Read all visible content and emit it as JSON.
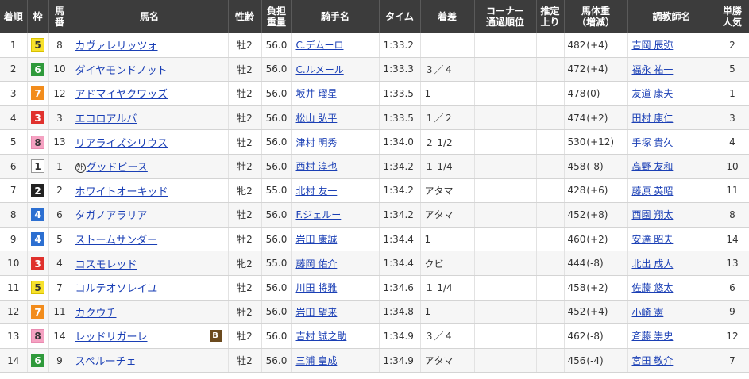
{
  "headers": {
    "rank": "着順",
    "waku": "枠",
    "umaban": [
      "馬",
      "番"
    ],
    "name": "馬名",
    "sexage": "性齢",
    "weight": [
      "負担",
      "重量"
    ],
    "jockey": "騎手名",
    "time": "タイム",
    "margin": "着差",
    "corner": [
      "コーナー",
      "通過順位"
    ],
    "last3f": [
      "推定",
      "上り"
    ],
    "bodyweight": [
      "馬体重",
      "（増減）"
    ],
    "trainer": "調教師名",
    "odds": [
      "単勝",
      "人気"
    ]
  },
  "waku_colors": {
    "1": {
      "bg": "#ffffff",
      "fg": "#333333",
      "border": "#999999"
    },
    "2": {
      "bg": "#222222",
      "fg": "#ffffff",
      "border": "#222222"
    },
    "3": {
      "bg": "#e0312d",
      "fg": "#ffffff",
      "border": "#e0312d"
    },
    "4": {
      "bg": "#2c6fd1",
      "fg": "#ffffff",
      "border": "#2c6fd1"
    },
    "5": {
      "bg": "#f7e12c",
      "fg": "#333333",
      "border": "#d8c000"
    },
    "6": {
      "bg": "#2f9a3b",
      "fg": "#ffffff",
      "border": "#2f9a3b"
    },
    "7": {
      "bg": "#f28c1c",
      "fg": "#ffffff",
      "border": "#f28c1c"
    },
    "8": {
      "bg": "#f5a2c2",
      "fg": "#333333",
      "border": "#e98ab0"
    }
  },
  "rows": [
    {
      "rank": "1",
      "waku": "5",
      "umaban": "8",
      "name": "カヴァレリッツォ",
      "marker": "",
      "blinker": "",
      "sexage": "牡2",
      "weight": "56.0",
      "jockey": "C.デムーロ",
      "time": "1:33.2",
      "margin": "",
      "corner": "",
      "last3f": "",
      "bw": "482",
      "bwd": "(+4)",
      "trainer": "吉岡 辰弥",
      "pop": "2"
    },
    {
      "rank": "2",
      "waku": "6",
      "umaban": "10",
      "name": "ダイヤモンドノット",
      "marker": "",
      "blinker": "",
      "sexage": "牡2",
      "weight": "56.0",
      "jockey": "C.ルメール",
      "time": "1:33.3",
      "margin": "３／４",
      "corner": "",
      "last3f": "",
      "bw": "472",
      "bwd": "(+4)",
      "trainer": "福永 祐一",
      "pop": "5"
    },
    {
      "rank": "3",
      "waku": "7",
      "umaban": "12",
      "name": "アドマイヤクワッズ",
      "marker": "",
      "blinker": "",
      "sexage": "牡2",
      "weight": "56.0",
      "jockey": "坂井 瑠星",
      "time": "1:33.5",
      "margin": "1",
      "corner": "",
      "last3f": "",
      "bw": "478",
      "bwd": "(0)",
      "trainer": "友道 康夫",
      "pop": "1"
    },
    {
      "rank": "4",
      "waku": "3",
      "umaban": "3",
      "name": "エコロアルバ",
      "marker": "",
      "blinker": "",
      "sexage": "牡2",
      "weight": "56.0",
      "jockey": "松山 弘平",
      "time": "1:33.5",
      "margin": "１／２",
      "corner": "",
      "last3f": "",
      "bw": "474",
      "bwd": "(+2)",
      "trainer": "田村 康仁",
      "pop": "3"
    },
    {
      "rank": "5",
      "waku": "8",
      "umaban": "13",
      "name": "リアライズシリウス",
      "marker": "",
      "blinker": "",
      "sexage": "牡2",
      "weight": "56.0",
      "jockey": "津村 明秀",
      "time": "1:34.0",
      "margin": "２ 1/2",
      "corner": "",
      "last3f": "",
      "bw": "530",
      "bwd": "(+12)",
      "trainer": "手塚 貴久",
      "pop": "4"
    },
    {
      "rank": "6",
      "waku": "1",
      "umaban": "1",
      "name": "グッドピース",
      "marker": "外",
      "blinker": "",
      "sexage": "牡2",
      "weight": "56.0",
      "jockey": "西村 淳也",
      "time": "1:34.2",
      "margin": "１ 1/4",
      "corner": "",
      "last3f": "",
      "bw": "458",
      "bwd": "(-8)",
      "trainer": "高野 友和",
      "pop": "10"
    },
    {
      "rank": "7",
      "waku": "2",
      "umaban": "2",
      "name": "ホワイトオーキッド",
      "marker": "",
      "blinker": "",
      "sexage": "牝2",
      "weight": "55.0",
      "jockey": "北村 友一",
      "time": "1:34.2",
      "margin": "アタマ",
      "corner": "",
      "last3f": "",
      "bw": "428",
      "bwd": "(+6)",
      "trainer": "藤原 英昭",
      "pop": "11"
    },
    {
      "rank": "8",
      "waku": "4",
      "umaban": "6",
      "name": "タガノアラリア",
      "marker": "",
      "blinker": "",
      "sexage": "牡2",
      "weight": "56.0",
      "jockey": "F.ジェルー",
      "time": "1:34.2",
      "margin": "アタマ",
      "corner": "",
      "last3f": "",
      "bw": "452",
      "bwd": "(+8)",
      "trainer": "西園 翔太",
      "pop": "8"
    },
    {
      "rank": "9",
      "waku": "4",
      "umaban": "5",
      "name": "ストームサンダー",
      "marker": "",
      "blinker": "",
      "sexage": "牡2",
      "weight": "56.0",
      "jockey": "岩田 康誠",
      "time": "1:34.4",
      "margin": "1",
      "corner": "",
      "last3f": "",
      "bw": "460",
      "bwd": "(+2)",
      "trainer": "安達 昭夫",
      "pop": "14"
    },
    {
      "rank": "10",
      "waku": "3",
      "umaban": "4",
      "name": "コスモレッド",
      "marker": "",
      "blinker": "",
      "sexage": "牝2",
      "weight": "55.0",
      "jockey": "藤岡 佑介",
      "time": "1:34.4",
      "margin": "クビ",
      "corner": "",
      "last3f": "",
      "bw": "444",
      "bwd": "(-8)",
      "trainer": "北出 成人",
      "pop": "13"
    },
    {
      "rank": "11",
      "waku": "5",
      "umaban": "7",
      "name": "コルテオソレイユ",
      "marker": "",
      "blinker": "",
      "sexage": "牡2",
      "weight": "56.0",
      "jockey": "川田 将雅",
      "time": "1:34.6",
      "margin": "１ 1/4",
      "corner": "",
      "last3f": "",
      "bw": "458",
      "bwd": "(+2)",
      "trainer": "佐藤 悠太",
      "pop": "6"
    },
    {
      "rank": "12",
      "waku": "7",
      "umaban": "11",
      "name": "カクウチ",
      "marker": "",
      "blinker": "",
      "sexage": "牡2",
      "weight": "56.0",
      "jockey": "岩田 望来",
      "time": "1:34.8",
      "margin": "1",
      "corner": "",
      "last3f": "",
      "bw": "452",
      "bwd": "(+4)",
      "trainer": "小崎 憲",
      "pop": "9"
    },
    {
      "rank": "13",
      "waku": "8",
      "umaban": "14",
      "name": "レッドリガーレ",
      "marker": "",
      "blinker": "B",
      "sexage": "牡2",
      "weight": "56.0",
      "jockey": "吉村 誠之助",
      "time": "1:34.9",
      "margin": "３／４",
      "corner": "",
      "last3f": "",
      "bw": "462",
      "bwd": "(-8)",
      "trainer": "斉藤 崇史",
      "pop": "12"
    },
    {
      "rank": "14",
      "waku": "6",
      "umaban": "9",
      "name": "スペルーチェ",
      "marker": "",
      "blinker": "",
      "sexage": "牡2",
      "weight": "56.0",
      "jockey": "三浦 皇成",
      "time": "1:34.9",
      "margin": "アタマ",
      "corner": "",
      "last3f": "",
      "bw": "456",
      "bwd": "(-4)",
      "trainer": "宮田 敬介",
      "pop": "7"
    }
  ]
}
